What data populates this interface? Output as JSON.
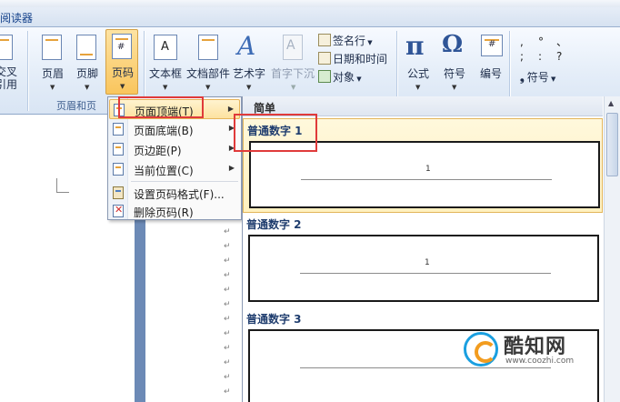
{
  "window": {
    "tab_label": "阅读器"
  },
  "ribbon": {
    "buttons": {
      "cross_ref": "交叉\n引用",
      "header": "页眉",
      "footer": "页脚",
      "page_number": "页码",
      "text_box": "文本框",
      "quick_parts": "文档部件",
      "wordart": "艺术字",
      "drop_cap": "首字下沉",
      "equation": "公式",
      "symbol": "符号",
      "numbering": "编号"
    },
    "small_commands": {
      "signature_line": "签名行",
      "date_time": "日期和时间",
      "object": "对象",
      "special_symbol": "符号"
    },
    "group_label": "页眉和页"
  },
  "menu": {
    "items": [
      {
        "label": "页面顶端(T)",
        "has_submenu": true
      },
      {
        "label": "页面底端(B)",
        "has_submenu": true
      },
      {
        "label": "页边距(P)",
        "has_submenu": true
      },
      {
        "label": "当前位置(C)",
        "has_submenu": true
      },
      {
        "label": "设置页码格式(F)...",
        "has_submenu": false
      },
      {
        "label": "删除页码(R)",
        "has_submenu": false
      }
    ]
  },
  "gallery": {
    "header": "简单",
    "items": [
      {
        "title": "普通数字 1",
        "number": "1"
      },
      {
        "title": "普通数字 2",
        "number": "1"
      },
      {
        "title": "普通数字 3",
        "number": ""
      }
    ]
  },
  "paragraph_mark": "↵",
  "watermark": {
    "title": "酷知网",
    "url": "www.coozhi.com"
  },
  "colors": {
    "accent_red": "#e03a3a",
    "ribbon_active": "#f9c55d",
    "title_text": "#15428b"
  }
}
